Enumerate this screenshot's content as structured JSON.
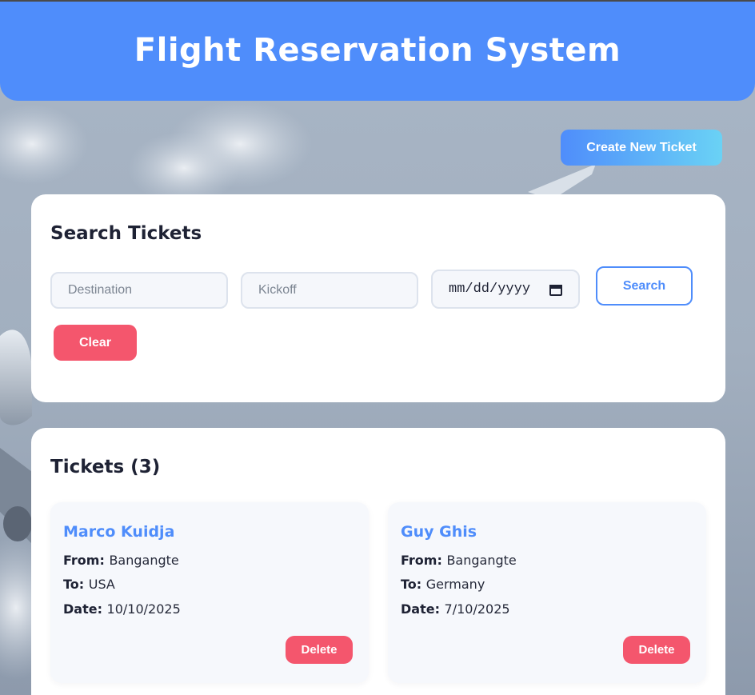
{
  "header": {
    "title": "Flight Reservation System"
  },
  "actions": {
    "create_label": "Create New Ticket"
  },
  "search": {
    "title": "Search Tickets",
    "destination_placeholder": "Destination",
    "kickoff_placeholder": "Kickoff",
    "date_placeholder": "mm/dd/yyyy",
    "search_label": "Search",
    "clear_label": "Clear"
  },
  "tickets": {
    "title": "Tickets (3)",
    "from_label": "From:",
    "to_label": "To:",
    "date_label": "Date:",
    "delete_label": "Delete",
    "items": [
      {
        "name": "Marco Kuidja",
        "from": "Bangangte",
        "to": "USA",
        "date": "10/10/2025"
      },
      {
        "name": "Guy Ghis",
        "from": "Bangangte",
        "to": "Germany",
        "date": "7/10/2025"
      }
    ]
  },
  "colors": {
    "primary": "#4f8dfb",
    "danger": "#f4566d",
    "gradient_end": "#6ad2f5",
    "text_dark": "#1e2234"
  }
}
